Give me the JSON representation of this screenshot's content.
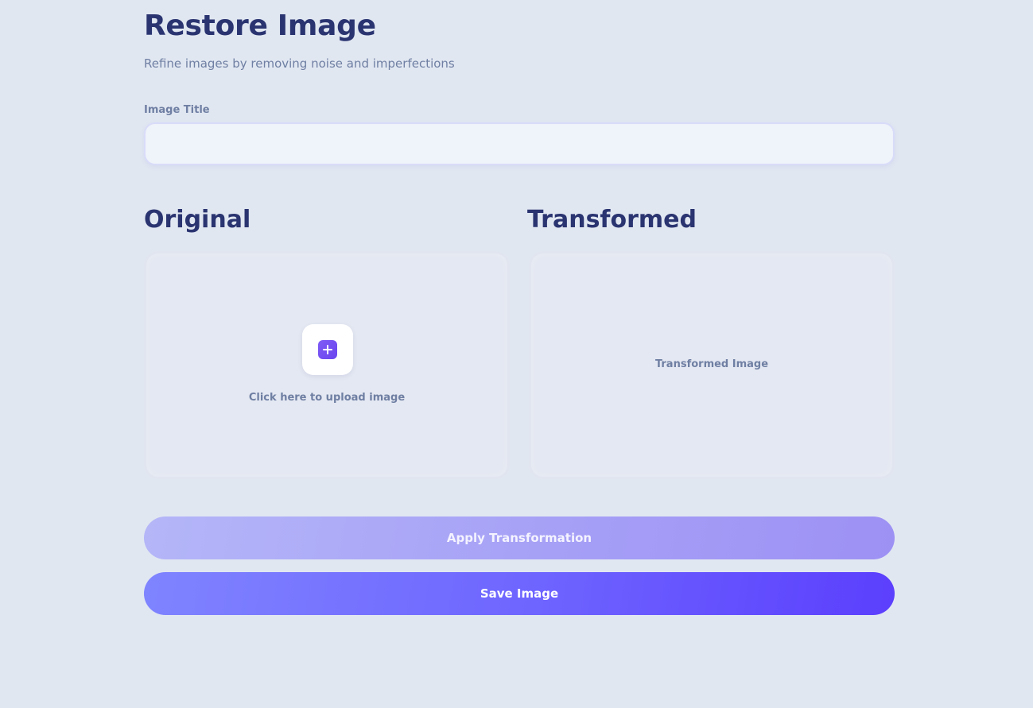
{
  "header": {
    "title": "Restore Image",
    "subtitle": "Refine images by removing noise and imperfections"
  },
  "form": {
    "title_label": "Image Title",
    "title_value": "",
    "title_placeholder": ""
  },
  "panels": {
    "original": {
      "heading": "Original",
      "upload_text": "Click here to upload image",
      "icon": "plus-icon"
    },
    "transformed": {
      "heading": "Transformed",
      "placeholder_text": "Transformed Image"
    }
  },
  "actions": {
    "apply_label": "Apply Transformation",
    "save_label": "Save Image"
  },
  "colors": {
    "background": "#e1e7f1",
    "heading": "#2a3470",
    "muted_text": "#6f7fa3",
    "accent": "#6a44ee",
    "apply_button": "#a59ef6",
    "save_button": "#6f66ff"
  }
}
